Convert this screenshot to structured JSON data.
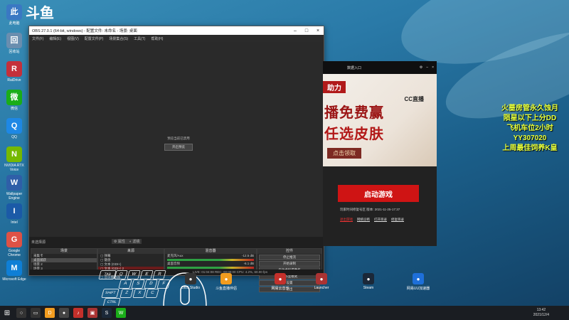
{
  "streamer_logo": "斗鱼",
  "desktop_icons": [
    {
      "label": "此电脑",
      "icon": "computer-icon",
      "color": "#3a78c3"
    },
    {
      "label": "回收站",
      "icon": "recycle-bin-icon",
      "color": "#6a8eaf"
    },
    {
      "label": "RaiDrive",
      "icon": "raidrive-icon",
      "color": "#c4303b"
    },
    {
      "label": "微信",
      "icon": "wechat-icon",
      "color": "#1aad19"
    },
    {
      "label": "QQ",
      "icon": "qq-icon",
      "color": "#1e88e5"
    },
    {
      "label": "NVIDIA RTX Voice",
      "icon": "nvidia-icon",
      "color": "#76b900"
    },
    {
      "label": "Wallpaper Engine",
      "icon": "wallpaper-engine-icon",
      "color": "#2f5fa8"
    },
    {
      "label": "Intel",
      "icon": "intel-icon",
      "color": "#1b5aa7"
    },
    {
      "label": "Google Chrome",
      "icon": "chrome-icon",
      "color": "#de5246"
    },
    {
      "label": "Microsoft Edge",
      "icon": "edge-icon",
      "color": "#0f7fd6"
    }
  ],
  "obs": {
    "title": "OBS 27.0.1 (64-bit, windows) - 配置文件: 未命名 - 场景: 桌面",
    "menu": [
      "文件(F)",
      "编辑(E)",
      "视图(V)",
      "配置文件(P)",
      "场景集合(S)",
      "工具(T)",
      "帮助(H)"
    ],
    "preview_msg": "预览当前已禁用",
    "preview_btn": "开启预览",
    "no_source": "未选择源",
    "properties_btn": "属性",
    "filters_btn": "滤镜",
    "docks": {
      "scenes": {
        "title": "场景",
        "items": [
          "采集卡",
          "桌面捕获",
          "场景 2",
          "场景 3"
        ]
      },
      "sources": {
        "title": "来源",
        "items": [
          "弹幕",
          "键盘",
          "文本 (GDI+)",
          "文本 (GDI+) 2",
          "斗鱼伴侣",
          "音乐播放器"
        ]
      },
      "mixer": {
        "title": "混音器",
        "tracks": [
          {
            "name": "麦克风/Aux",
            "db": "-12.5 dB"
          },
          {
            "name": "桌面音频",
            "db": "-6.1 dB"
          }
        ]
      },
      "controls": {
        "title": "控件",
        "buttons": [
          "停止推流",
          "开始录制",
          "启动虚拟摄像机",
          "工作室模式",
          "设置",
          "退出"
        ]
      }
    },
    "status": "LIVE: 01:04:08   REC: 00:00:00   CPU: 4.2%, 60.00 fps"
  },
  "launcher": {
    "top_label": "数据入口",
    "banner_line1": "助力",
    "banner_line2": "播免费赢",
    "banner_line3": "任选皮肤",
    "banner_button": "点击领取",
    "banner_brand": "CC直播",
    "start_button": "启动游戏",
    "info": "玩家时间修复号区   版本: 2021-11-25-17:37",
    "links": [
      "退出游戏",
      "网络诊断",
      "打开目录",
      "修复目录"
    ]
  },
  "overlay_text": [
    "火蔷房管永久蚀月",
    "陨星以下上分DD",
    "飞机车位2小时",
    "YY307020",
    "上周最佳饲养K皇"
  ],
  "taskbar_apps": [
    {
      "label": "OBS Studio",
      "icon": "obs-icon"
    },
    {
      "label": "斗鱼直播伴侣",
      "icon": "douyu-icon"
    },
    {
      "label": "网易云音乐",
      "icon": "netease-music-icon"
    },
    {
      "label": "Launcher",
      "icon": "launcher-icon"
    },
    {
      "label": "Steam",
      "icon": "steam-icon"
    },
    {
      "label": "网易UU加速器",
      "icon": "uu-icon"
    }
  ],
  "keyboard_keys": [
    "TAB",
    "Q",
    "W",
    "E",
    "R",
    "A",
    "S",
    "D",
    "F",
    "SHIFT",
    "Z",
    "X",
    "C",
    "CTRL"
  ],
  "clock": {
    "time": "13:42",
    "date": "2021/12/4"
  }
}
